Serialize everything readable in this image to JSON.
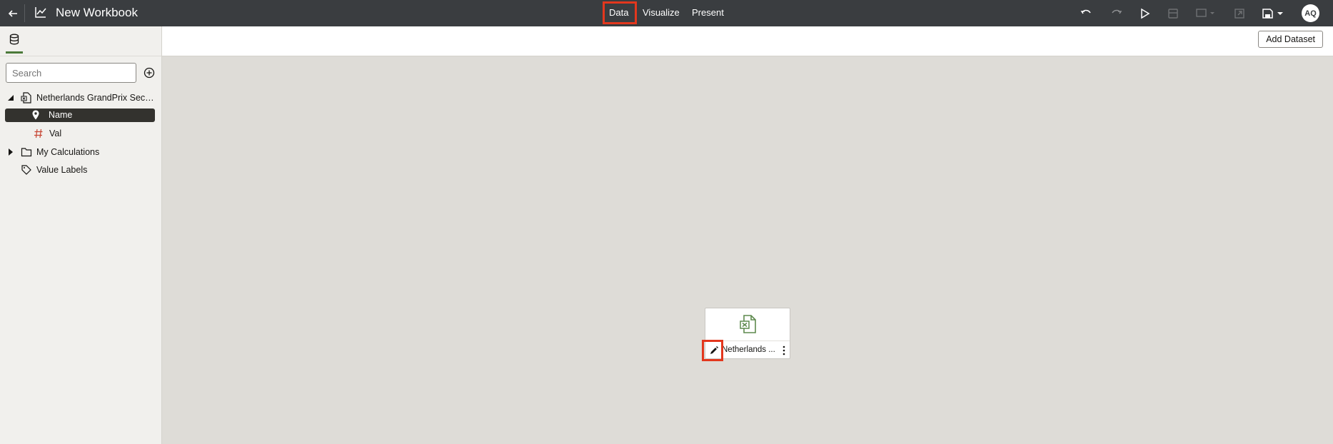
{
  "header": {
    "title": "New Workbook",
    "nav": [
      "Data",
      "Visualize",
      "Present"
    ],
    "avatar_initials": "AQ"
  },
  "left_panel": {
    "search_placeholder": "Search",
    "dataset_name": "Netherlands GrandPrix Sec…",
    "fields": [
      {
        "label": "Name",
        "icon": "location-pin-icon"
      },
      {
        "label": "Val",
        "icon": "hash-icon"
      }
    ],
    "my_calculations": "My Calculations",
    "value_labels": "Value Labels"
  },
  "main": {
    "add_dataset_label": "Add Dataset",
    "card_label": "Netherlands ..."
  },
  "colors": {
    "topbar": "#3a3d40",
    "highlight": "#e3371d",
    "accent_green": "#4b7a3a",
    "hash_red": "#c74634"
  }
}
